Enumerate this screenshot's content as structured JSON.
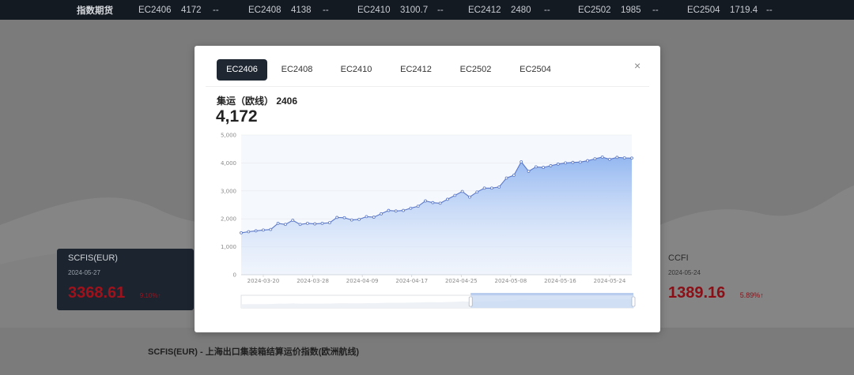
{
  "ticker": {
    "title": "指数期货",
    "items": [
      {
        "code": "EC2406",
        "price": "4172",
        "change": "--"
      },
      {
        "code": "EC2408",
        "price": "4138",
        "change": "--"
      },
      {
        "code": "EC2410",
        "price": "3100.7",
        "change": "--"
      },
      {
        "code": "EC2412",
        "price": "2480",
        "change": "--"
      },
      {
        "code": "EC2502",
        "price": "1985",
        "change": "--"
      },
      {
        "code": "EC2504",
        "price": "1719.4",
        "change": "--"
      }
    ]
  },
  "cards": {
    "left": {
      "title": "SCFIS(EUR)",
      "date": "2024-05-27",
      "value": "3368.61",
      "change": "9.10%↑"
    },
    "right": {
      "title": "CCFI",
      "date": "2024-05-24",
      "value": "1389.16",
      "change": "5.89%↑"
    }
  },
  "bottom_caption": "SCFIS(EUR) - 上海出口集装箱结算运价指数(欧洲航线)",
  "modal": {
    "tabs": [
      "EC2406",
      "EC2408",
      "EC2410",
      "EC2412",
      "EC2502",
      "EC2504"
    ],
    "active_tab": 0,
    "close": "×",
    "instrument_title": "集运（欧线） 2406",
    "price": "4,172"
  },
  "colors": {
    "accent_dark": "#1f2733",
    "line": "#5b78c7",
    "area_top": "#8fb4f0",
    "up_red": "#a0121b"
  },
  "chart_data": {
    "type": "area",
    "ylim": [
      0,
      5000
    ],
    "yticks": [
      "0",
      "1,000",
      "2,000",
      "3,000",
      "4,000",
      "5,000"
    ],
    "xticks": [
      "2024-03-20",
      "2024-03-28",
      "2024-04-09",
      "2024-04-17",
      "2024-04-25",
      "2024-05-08",
      "2024-05-16",
      "2024-05-24"
    ],
    "series": [
      {
        "values": [
          1500,
          1540,
          1570,
          1600,
          1620,
          1840,
          1800,
          1950,
          1800,
          1840,
          1820,
          1840,
          1860,
          2050,
          2040,
          1960,
          1980,
          2080,
          2060,
          2180,
          2300,
          2280,
          2300,
          2380,
          2450,
          2640,
          2580,
          2560,
          2700,
          2840,
          2980,
          2780,
          2960,
          3100,
          3100,
          3140,
          3460,
          3560,
          4040,
          3700,
          3860,
          3840,
          3900,
          3960,
          4000,
          4020,
          4030,
          4080,
          4150,
          4210,
          4130,
          4200,
          4180,
          4172
        ]
      }
    ],
    "slider_window": [
      0.585,
      1.0
    ]
  }
}
